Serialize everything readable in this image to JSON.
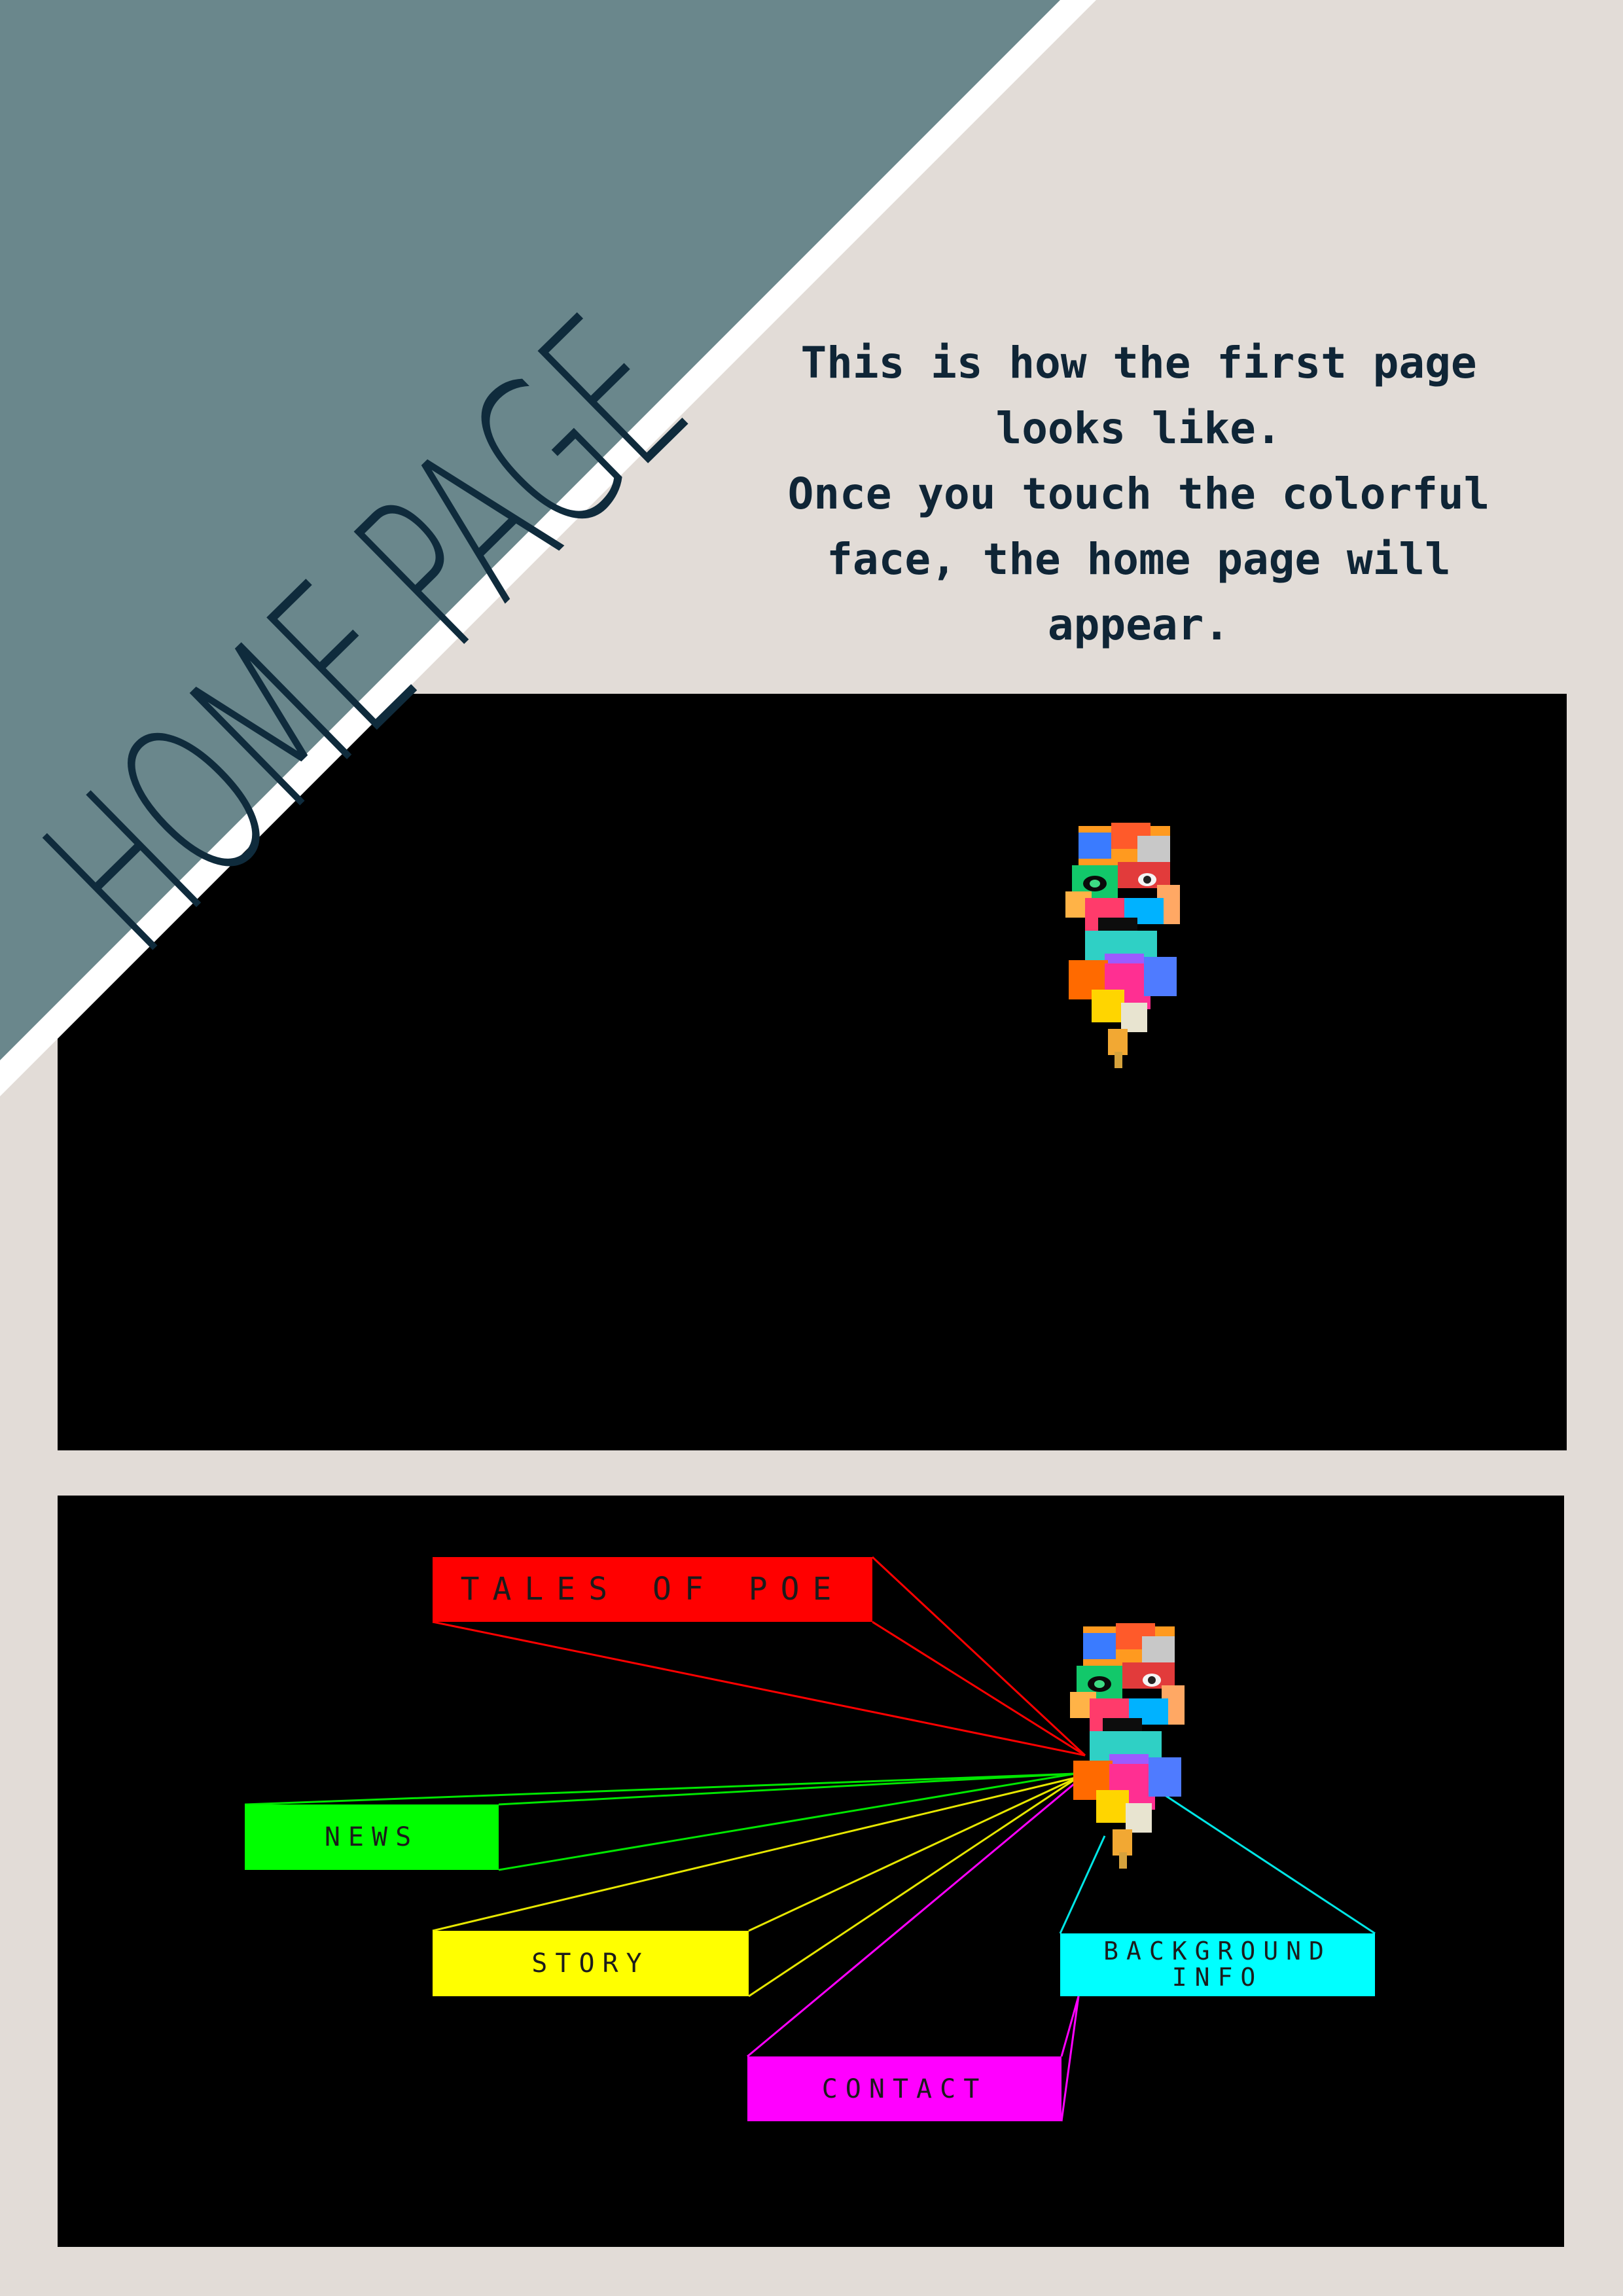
{
  "page": {
    "title": "HOME PAGE",
    "description_lines": [
      "This is how the first page",
      "looks like.",
      "Once you touch the colorful",
      "face, the home page will",
      "appear."
    ]
  },
  "colors": {
    "background": "#e2dcd7",
    "diagonal_panel": "#6a878c",
    "diagonal_stripe": "#ffffff",
    "text_dark": "#0f2536",
    "screen": "#000000"
  },
  "landing_screen": {
    "face_icon": "colorful-face-icon"
  },
  "home_screen": {
    "face_icon": "colorful-face-icon",
    "menu": {
      "tales": {
        "label": "TALES OF POE",
        "color": "#ff0000"
      },
      "news": {
        "label": "NEWS",
        "color": "#00ff00"
      },
      "story": {
        "label": "STORY",
        "color": "#ffff00"
      },
      "background_line1": "BACKGROUND",
      "background_line2": "INFO",
      "background_color": "#00ffff",
      "contact": {
        "label": "CONTACT",
        "color": "#ff00ff"
      }
    }
  }
}
